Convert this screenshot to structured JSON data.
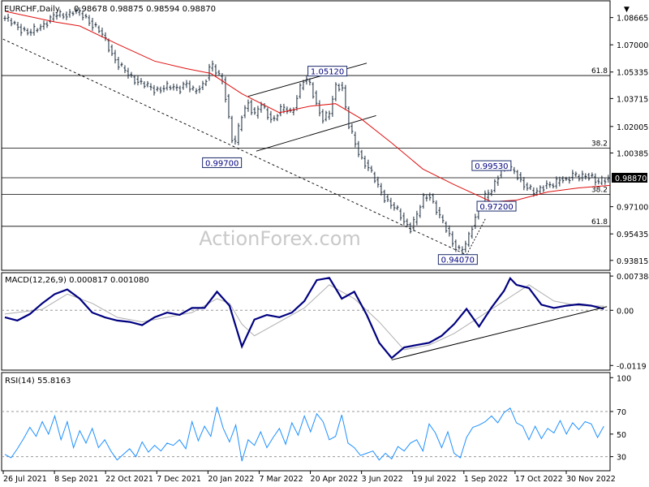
{
  "chart_data": {
    "type": "line",
    "instrument_label": "EURCHF,Daily",
    "ohlc_label": "0.98678 0.98875 0.98594 0.98870",
    "watermark": "ActionForex.com",
    "x_ticks": [
      "26 Jul 2021",
      "8 Sep 2021",
      "22 Oct 2021",
      "7 Dec 2021",
      "20 Jan 2022",
      "7 Mar 2022",
      "20 Apr 2022",
      "3 Jun 2022",
      "19 Jul 2022",
      "1 Sep 2022",
      "17 Oct 2022",
      "30 Nov 2022"
    ],
    "price": {
      "y_range": [
        0.9321,
        1.0969
      ],
      "y_ticks": [
        "1.08665",
        "1.07000",
        "1.05335",
        "1.03715",
        "1.02005",
        "1.00385",
        "0.98870",
        "0.97100",
        "0.95435",
        "0.93815"
      ],
      "current_price": "0.98870",
      "close_path": [
        [
          0,
          1.0862
        ],
        [
          2,
          1.081
        ],
        [
          4,
          1.077
        ],
        [
          6,
          1.082
        ],
        [
          8,
          1.088
        ],
        [
          10,
          1.0885
        ],
        [
          11,
          1.0905
        ],
        [
          12,
          1.089
        ],
        [
          13,
          1.0865
        ],
        [
          14,
          1.0825
        ],
        [
          15,
          1.079
        ],
        [
          16,
          1.0735
        ],
        [
          17,
          1.066
        ],
        [
          18,
          1.0585
        ],
        [
          20,
          1.051
        ],
        [
          22,
          1.046
        ],
        [
          24,
          1.0425
        ],
        [
          26,
          1.044
        ],
        [
          28,
          1.0435
        ],
        [
          29,
          1.047
        ],
        [
          30,
          1.041
        ],
        [
          31,
          1.0432
        ],
        [
          32,
          1.047
        ],
        [
          33,
          1.0585
        ],
        [
          34,
          1.052
        ],
        [
          35,
          1.048
        ],
        [
          36,
          1.022
        ],
        [
          36.6,
          1.0075
        ],
        [
          37,
          1.011
        ],
        [
          38,
          1.0275
        ],
        [
          39,
          1.035
        ],
        [
          40,
          1.0265
        ],
        [
          41,
          1.0335
        ],
        [
          42,
          1.028
        ],
        [
          43,
          1.0235
        ],
        [
          44,
          1.03
        ],
        [
          45,
          1.031
        ],
        [
          46,
          1.028
        ],
        [
          47,
          1.041
        ],
        [
          48,
          1.049
        ],
        [
          49,
          1.0455
        ],
        [
          50,
          1.033
        ],
        [
          51,
          1.024
        ],
        [
          52,
          1.028
        ],
        [
          53,
          1.045
        ],
        [
          54,
          1.0455
        ],
        [
          55,
          1.0215
        ],
        [
          56,
          1.011
        ],
        [
          57,
          1.0015
        ],
        [
          58,
          0.9962
        ],
        [
          59,
          0.9895
        ],
        [
          60,
          0.982
        ],
        [
          61,
          0.976
        ],
        [
          62,
          0.9715
        ],
        [
          63,
          0.968
        ],
        [
          64,
          0.962
        ],
        [
          65,
          0.958
        ],
        [
          66,
          0.965
        ],
        [
          67,
          0.976
        ],
        [
          68,
          0.979
        ],
        [
          69,
          0.97
        ],
        [
          70,
          0.962
        ],
        [
          71,
          0.956
        ],
        [
          72,
          0.9475
        ],
        [
          73,
          0.9432
        ],
        [
          74,
          0.9485
        ],
        [
          75,
          0.961
        ],
        [
          76,
          0.9705
        ],
        [
          77,
          0.977
        ],
        [
          78,
          0.981
        ],
        [
          79,
          0.99
        ],
        [
          80,
          0.9965
        ],
        [
          81,
          0.9938
        ],
        [
          82,
          0.9915
        ],
        [
          83,
          0.985
        ],
        [
          84,
          0.9815
        ],
        [
          85,
          0.979
        ],
        [
          86,
          0.9835
        ],
        [
          87,
          0.9845
        ],
        [
          88,
          0.9835
        ],
        [
          89,
          0.9885
        ],
        [
          90,
          0.9875
        ],
        [
          91,
          0.9905
        ],
        [
          92,
          0.9885
        ],
        [
          93,
          0.9905
        ],
        [
          94,
          0.9898
        ],
        [
          95,
          0.985
        ],
        [
          96,
          0.9875
        ],
        [
          97,
          0.9887
        ]
      ],
      "sma_path": [
        [
          0,
          1.0905
        ],
        [
          8,
          1.084
        ],
        [
          12,
          1.0815
        ],
        [
          18,
          1.0705
        ],
        [
          24,
          1.06
        ],
        [
          29,
          1.0555
        ],
        [
          33,
          1.0525
        ],
        [
          38,
          1.04
        ],
        [
          44,
          1.0285
        ],
        [
          49,
          1.0325
        ],
        [
          53,
          1.034
        ],
        [
          57,
          1.025
        ],
        [
          62,
          1.01
        ],
        [
          67,
          0.994
        ],
        [
          72,
          0.9845
        ],
        [
          78,
          0.974
        ],
        [
          82,
          0.975
        ],
        [
          87,
          0.98
        ],
        [
          92,
          0.9825
        ],
        [
          97,
          0.984
        ]
      ],
      "horizontal_levels": [
        {
          "price": 1.0512,
          "label": "61.8"
        },
        {
          "price": 1.0068,
          "label": "38.2"
        },
        {
          "price": 0.9887,
          "label": ""
        },
        {
          "price": 0.9785,
          "label": "38.2"
        },
        {
          "price": 0.959,
          "label": "61.8"
        }
      ],
      "trend_lines": [
        {
          "from": [
            -0.3,
            1.0735
          ],
          "to": [
            74,
            0.9415
          ],
          "style": "dashed"
        },
        {
          "from": [
            39,
            1.0385
          ],
          "to": [
            58,
            1.0588
          ],
          "style": "solid"
        },
        {
          "from": [
            40.3,
            1.005
          ],
          "to": [
            59.5,
            1.0267
          ],
          "style": "solid"
        },
        {
          "from": [
            74,
            0.9415
          ],
          "to": [
            77,
            0.9635
          ],
          "style": "dotted"
        }
      ],
      "price_labels": [
        {
          "text": "1.05120",
          "x": 51.7,
          "price": 1.0539
        },
        {
          "text": "0.99700",
          "x": 34.8,
          "price": 0.9979
        },
        {
          "text": "0.99530",
          "x": 78.0,
          "price": 0.9961
        },
        {
          "text": "0.97200",
          "x": 78.8,
          "price": 0.9713
        },
        {
          "text": "0.94070",
          "x": 72.6,
          "price": 0.9387
        }
      ]
    },
    "macd": {
      "label": "MACD(12,26,9) 0.000817 0.001080",
      "y_range": [
        -0.0129,
        0.0081
      ],
      "y_ticks": [
        "0.007384",
        "0.00",
        "-0.0119"
      ],
      "macd_path": [
        [
          0,
          -0.0015
        ],
        [
          2,
          -0.0022
        ],
        [
          4,
          -0.0008
        ],
        [
          6,
          0.0015
        ],
        [
          8,
          0.0035
        ],
        [
          10,
          0.0045
        ],
        [
          12,
          0.0025
        ],
        [
          14,
          -0.0005
        ],
        [
          16,
          -0.0015
        ],
        [
          18,
          -0.0022
        ],
        [
          20,
          -0.0025
        ],
        [
          22,
          -0.0032
        ],
        [
          24,
          -0.0015
        ],
        [
          26,
          -0.0005
        ],
        [
          28,
          -0.001
        ],
        [
          30,
          0.0005
        ],
        [
          32,
          0.0005
        ],
        [
          34,
          0.004
        ],
        [
          36,
          0.001
        ],
        [
          38,
          -0.0078
        ],
        [
          40,
          -0.002
        ],
        [
          42,
          -0.001
        ],
        [
          44,
          -0.0015
        ],
        [
          46,
          -0.0005
        ],
        [
          48,
          0.002
        ],
        [
          50,
          0.0065
        ],
        [
          52,
          0.007
        ],
        [
          54,
          0.0025
        ],
        [
          56,
          0.004
        ],
        [
          58,
          -0.001
        ],
        [
          60,
          -0.007
        ],
        [
          62,
          -0.0103
        ],
        [
          64,
          -0.008
        ],
        [
          66,
          -0.0075
        ],
        [
          68,
          -0.007
        ],
        [
          70,
          -0.0055
        ],
        [
          72,
          -0.003
        ],
        [
          74,
          0.0003
        ],
        [
          76,
          -0.0035
        ],
        [
          78,
          0.0006
        ],
        [
          80,
          0.0042
        ],
        [
          81,
          0.0069
        ],
        [
          82,
          0.0055
        ],
        [
          84,
          0.0048
        ],
        [
          86,
          0.0012
        ],
        [
          88,
          0.0005
        ],
        [
          90,
          0.001
        ],
        [
          92,
          0.0013
        ],
        [
          94,
          0.001
        ],
        [
          96,
          0.0003
        ]
      ],
      "signal_path": [
        [
          0,
          -0.0008
        ],
        [
          6,
          0.0002
        ],
        [
          10,
          0.0035
        ],
        [
          14,
          0.0015
        ],
        [
          18,
          -0.0015
        ],
        [
          22,
          -0.0025
        ],
        [
          26,
          -0.0015
        ],
        [
          30,
          -0.0005
        ],
        [
          34,
          0.0025
        ],
        [
          36,
          0.0015
        ],
        [
          38,
          -0.003
        ],
        [
          40,
          -0.0055
        ],
        [
          44,
          -0.0025
        ],
        [
          48,
          0.0005
        ],
        [
          52,
          0.0055
        ],
        [
          56,
          0.0025
        ],
        [
          60,
          -0.0025
        ],
        [
          64,
          -0.0085
        ],
        [
          68,
          -0.0075
        ],
        [
          72,
          -0.005
        ],
        [
          76,
          -0.0015
        ],
        [
          80,
          0.002
        ],
        [
          84,
          0.0055
        ],
        [
          88,
          0.002
        ],
        [
          92,
          0.001
        ],
        [
          96,
          0.0009
        ]
      ],
      "trend_line": {
        "from": [
          62,
          -0.0107
        ],
        "to": [
          96.5,
          0.0008
        ]
      }
    },
    "rsi": {
      "label": "RSI(14) 55.8163",
      "y_range": [
        17.5,
        104.5
      ],
      "y_ticks": [
        "100",
        "70",
        "50",
        "30"
      ],
      "dashed_levels": [
        70,
        30
      ],
      "rsi_path": [
        [
          0,
          32
        ],
        [
          1,
          29
        ],
        [
          2,
          37
        ],
        [
          3,
          46
        ],
        [
          4,
          56
        ],
        [
          5,
          48
        ],
        [
          6,
          61
        ],
        [
          7,
          50
        ],
        [
          8,
          66
        ],
        [
          9,
          45
        ],
        [
          10,
          61
        ],
        [
          11,
          38
        ],
        [
          12,
          53
        ],
        [
          13,
          42
        ],
        [
          14,
          55
        ],
        [
          15,
          38
        ],
        [
          16,
          45
        ],
        [
          17,
          35
        ],
        [
          18,
          27
        ],
        [
          19,
          32
        ],
        [
          20,
          37
        ],
        [
          21,
          30
        ],
        [
          22,
          43
        ],
        [
          23,
          34
        ],
        [
          24,
          40
        ],
        [
          25,
          35
        ],
        [
          26,
          42
        ],
        [
          27,
          40
        ],
        [
          28,
          45
        ],
        [
          29,
          37
        ],
        [
          30,
          61
        ],
        [
          31,
          44
        ],
        [
          32,
          57
        ],
        [
          33,
          48
        ],
        [
          34,
          74
        ],
        [
          35,
          55
        ],
        [
          36,
          43
        ],
        [
          37,
          58
        ],
        [
          38,
          26
        ],
        [
          39,
          45
        ],
        [
          40,
          40
        ],
        [
          41,
          52
        ],
        [
          42,
          38
        ],
        [
          43,
          47
        ],
        [
          44,
          55
        ],
        [
          45,
          41
        ],
        [
          46,
          60
        ],
        [
          47,
          49
        ],
        [
          48,
          66
        ],
        [
          49,
          52
        ],
        [
          50,
          68
        ],
        [
          51,
          61
        ],
        [
          52,
          45
        ],
        [
          53,
          48
        ],
        [
          54,
          67
        ],
        [
          55,
          42
        ],
        [
          56,
          38
        ],
        [
          57,
          31
        ],
        [
          58,
          33
        ],
        [
          59,
          35
        ],
        [
          60,
          27
        ],
        [
          61,
          33
        ],
        [
          62,
          28
        ],
        [
          63,
          39
        ],
        [
          64,
          35
        ],
        [
          65,
          42
        ],
        [
          66,
          45
        ],
        [
          67,
          35
        ],
        [
          68,
          59
        ],
        [
          69,
          51
        ],
        [
          70,
          38
        ],
        [
          71,
          52
        ],
        [
          72,
          33
        ],
        [
          73,
          29
        ],
        [
          74,
          47
        ],
        [
          75,
          56
        ],
        [
          76,
          58
        ],
        [
          77,
          61
        ],
        [
          78,
          66
        ],
        [
          79,
          60
        ],
        [
          80,
          69
        ],
        [
          81,
          73
        ],
        [
          82,
          60
        ],
        [
          83,
          57
        ],
        [
          84,
          45
        ],
        [
          85,
          57
        ],
        [
          86,
          46
        ],
        [
          87,
          55
        ],
        [
          88,
          51
        ],
        [
          89,
          62
        ],
        [
          90,
          50
        ],
        [
          91,
          60
        ],
        [
          92,
          54
        ],
        [
          93,
          61
        ],
        [
          94,
          59
        ],
        [
          95,
          47
        ],
        [
          96,
          57
        ]
      ]
    }
  }
}
